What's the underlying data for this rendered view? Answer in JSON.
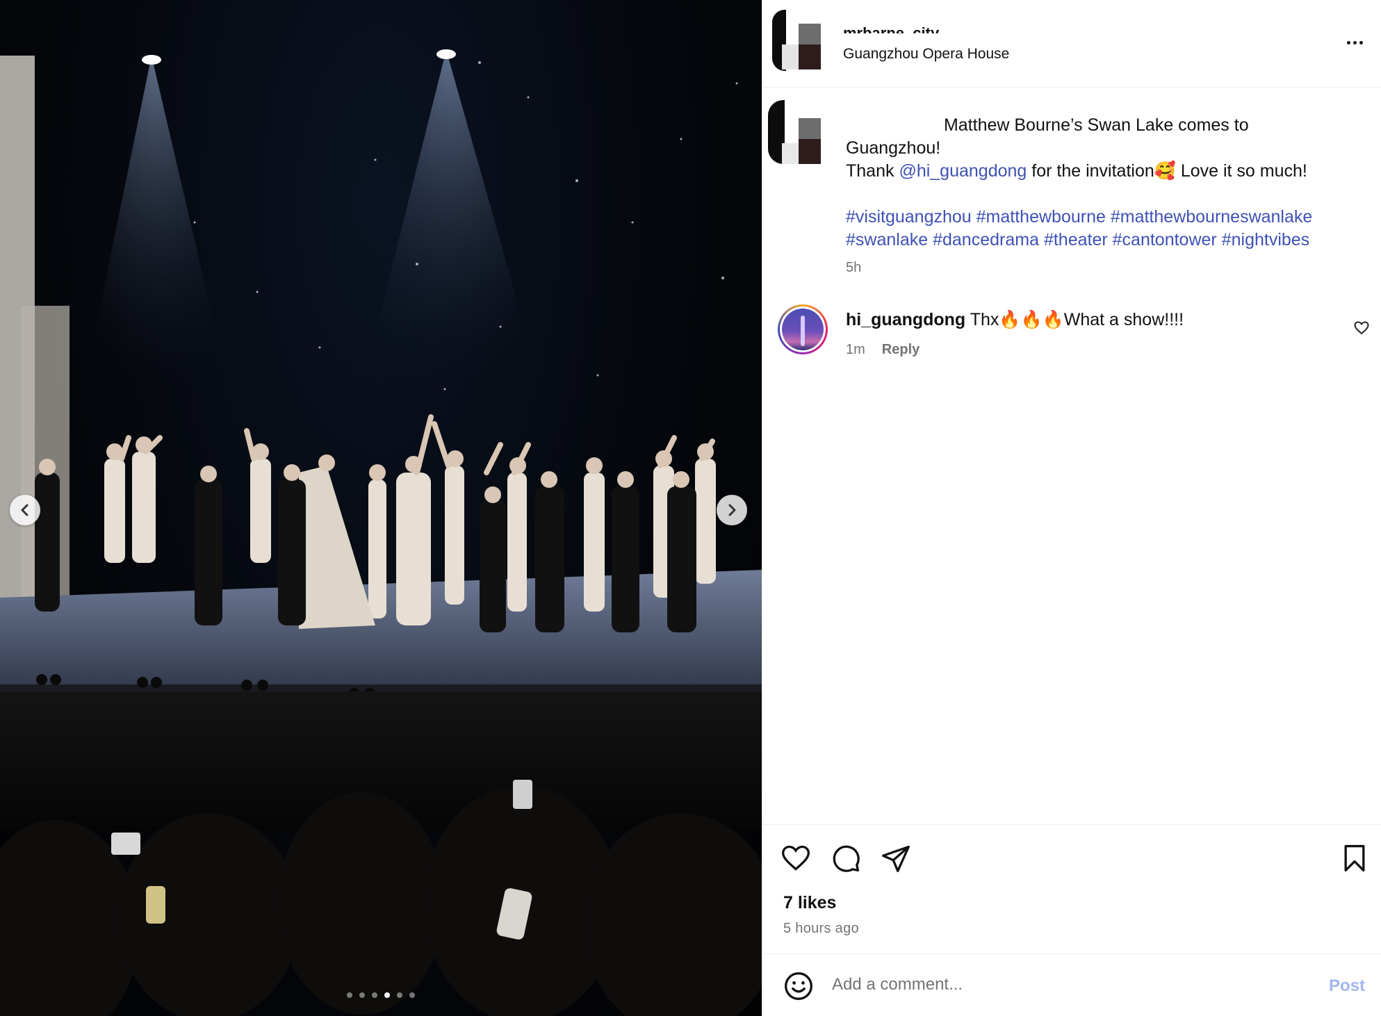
{
  "media": {
    "photo": "theatre-curtain-call",
    "carousel": {
      "total": 6,
      "active": 4
    }
  },
  "post": {
    "author": "mrbarne_city",
    "location": "Guangzhou Opera House",
    "caption": {
      "line1_text": " Matthew Bourne’s Swan Lake comes to",
      "line2_text": "Guangzhou!",
      "thank_prefix": "Thank ",
      "mention": "@hi_guangdong",
      "thank_suffix": " for the invitation🥰 Love it so much!",
      "hashtags": [
        "#visitguangzhou",
        "#matthewbourne",
        "#matthewbourneswanlake",
        "#swanlake",
        "#dancedrama",
        "#theater",
        "#cantontower",
        "#nightvibes"
      ]
    },
    "caption_time": "5h"
  },
  "comment": {
    "username": "hi_guangdong",
    "text": " Thx🔥🔥🔥What a show!!!!",
    "time": "1m",
    "reply_label": "Reply"
  },
  "stats": {
    "likes": "7 likes",
    "time_ago": "5 hours ago"
  },
  "composer": {
    "placeholder": "Add a comment...",
    "post_label": "Post"
  },
  "colors": {
    "link": "#3f51b5",
    "muted": "#737373",
    "post_button": "#a3b6f2"
  }
}
